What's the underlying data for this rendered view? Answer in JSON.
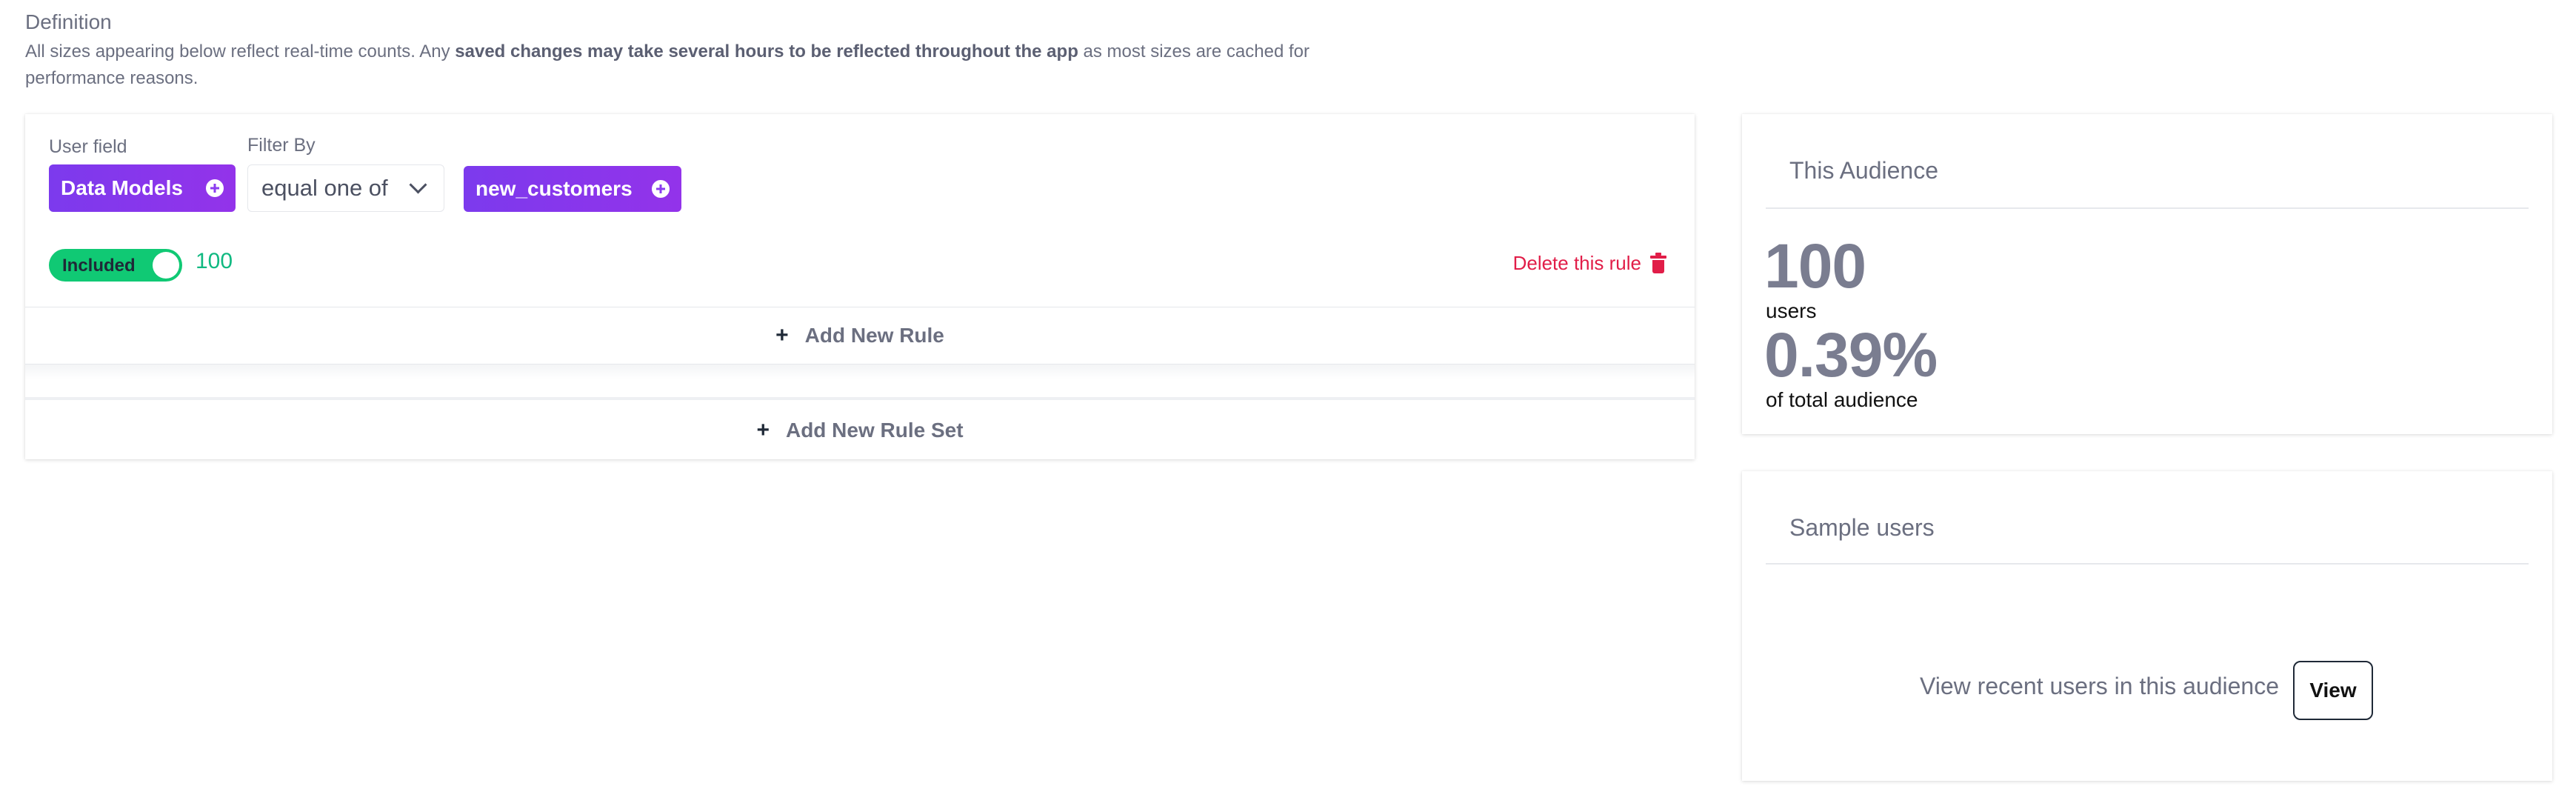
{
  "definition": {
    "title": "Definition",
    "text_part1": "All sizes appearing below reflect real-time counts. Any ",
    "text_bold": "saved changes may take several hours to be reflected throughout the app",
    "text_part2": " as most sizes are cached for performance reasons."
  },
  "rule": {
    "user_field_label": "User field",
    "user_field_value": "Data Models",
    "filter_by_label": "Filter By",
    "filter_value": "equal one of",
    "value_pill": "new_customers",
    "toggle_label": "Included",
    "count": "100",
    "delete_label": "Delete this rule"
  },
  "actions": {
    "add_rule": "Add New Rule",
    "add_rule_set": "Add New Rule Set"
  },
  "audience": {
    "title": "This Audience",
    "users_count": "100",
    "users_label": "users",
    "percent": "0.39%",
    "percent_label": "of total audience"
  },
  "sample": {
    "title": "Sample users",
    "text": "View recent users in this audience",
    "button": "View"
  },
  "colors": {
    "pill": "#8b3df0",
    "toggle": "#10c974",
    "delete": "#e11d48"
  }
}
